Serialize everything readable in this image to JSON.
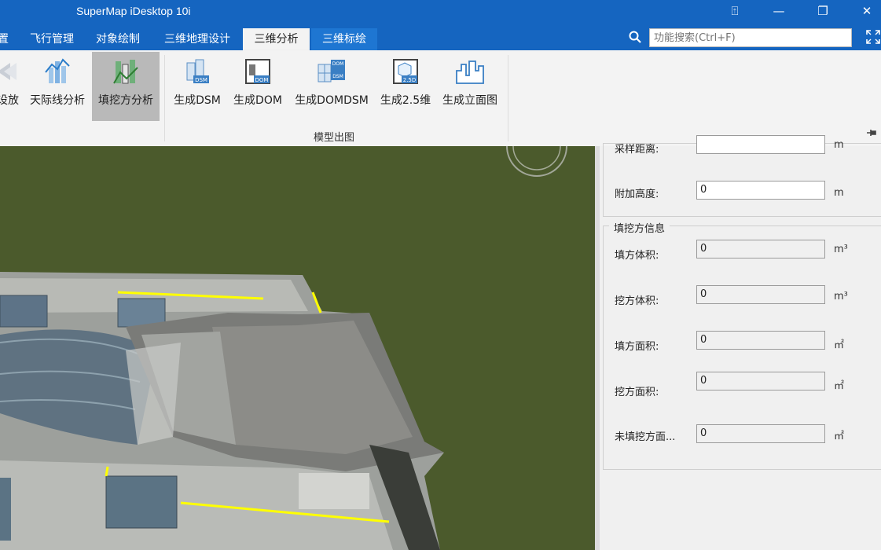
{
  "window": {
    "title": "SuperMap iDesktop 10i",
    "controls": [
      "⍐",
      "—",
      "❐",
      "✕"
    ]
  },
  "tabs": [
    {
      "label": "置"
    },
    {
      "label": "飞行管理"
    },
    {
      "label": "对象绘制"
    },
    {
      "label": "三维地理设计"
    },
    {
      "label": "三维分析",
      "active": true
    },
    {
      "label": "三维标绘"
    }
  ],
  "search": {
    "placeholder": "功能搜索(Ctrl+F)",
    "icon": "search-icon"
  },
  "ribbon": {
    "buttons": [
      {
        "label": "设放",
        "icon": "playback-icon"
      },
      {
        "label": "天际线分析",
        "icon": "skyline-icon"
      },
      {
        "label": "填挖方分析",
        "icon": "cut-fill-icon",
        "active": true
      },
      {
        "label": "生成DSM",
        "icon": "dsm-icon"
      },
      {
        "label": "生成DOM",
        "icon": "dom-icon"
      },
      {
        "label": "生成DOMDSM",
        "icon": "domdsm-icon"
      },
      {
        "label": "生成2.5维",
        "icon": "2.5d-icon"
      },
      {
        "label": "生成立面图",
        "icon": "elevation-icon"
      }
    ],
    "group_label": "模型出图"
  },
  "panel": {
    "top_fields": [
      {
        "label": "采样距离:",
        "value": "",
        "unit": "m"
      },
      {
        "label": "附加高度:",
        "value": "0",
        "unit": "m"
      }
    ],
    "info_group": {
      "title": "填挖方信息",
      "fields": [
        {
          "label": "填方体积:",
          "value": "0",
          "unit": "m³"
        },
        {
          "label": "挖方体积:",
          "value": "0",
          "unit": "m³"
        },
        {
          "label": "填方面积:",
          "value": "0",
          "unit": "㎡"
        },
        {
          "label": "挖方面积:",
          "value": "0",
          "unit": "㎡"
        },
        {
          "label": "未填挖方面...",
          "value": "0",
          "unit": "㎡"
        }
      ]
    }
  },
  "colors": {
    "accent": "#1565c0",
    "ground": "#4b5a2c",
    "measure_line": "#ffff00"
  }
}
